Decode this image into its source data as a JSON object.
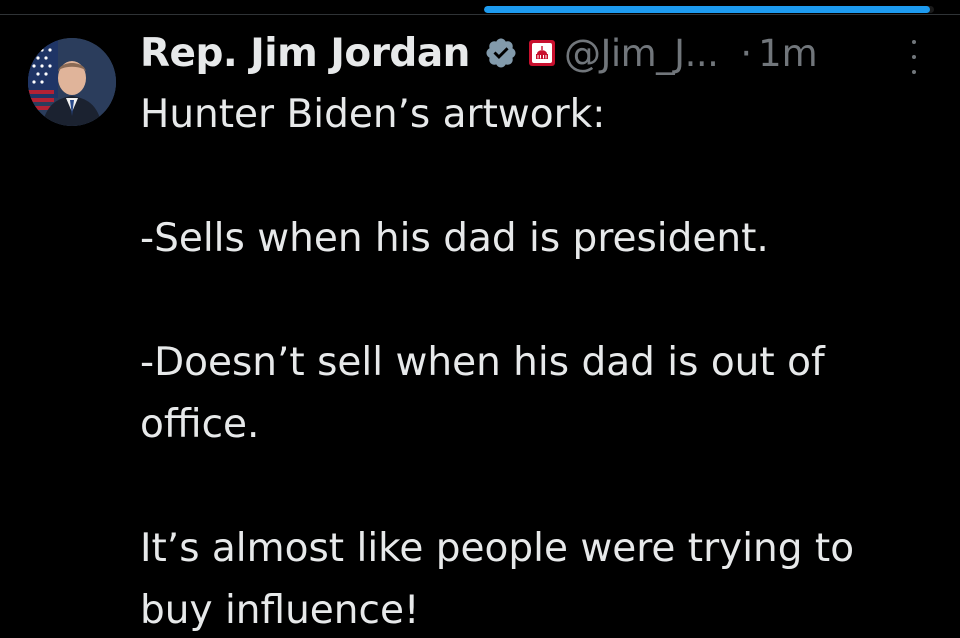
{
  "progress": {
    "fraction": 0.99,
    "color": "#1d9bf0"
  },
  "author": {
    "name": "Rep. Jim Jordan",
    "handle": "@Jim_J...",
    "separator": "·",
    "time": "1m",
    "verified_icon": "verified-badge-icon",
    "affiliate_icon": "government-badge-icon"
  },
  "tweet": {
    "lines": [
      "Hunter Biden’s artwork:",
      "-Sells when his dad is president.",
      "-Doesn’t sell when his dad is out of",
      "office.",
      "It’s almost like people were trying to",
      "buy influence!"
    ]
  },
  "colors": {
    "background": "#000000",
    "text": "#e7e9ea",
    "secondary": "#71767b",
    "accent": "#1d9bf0"
  }
}
